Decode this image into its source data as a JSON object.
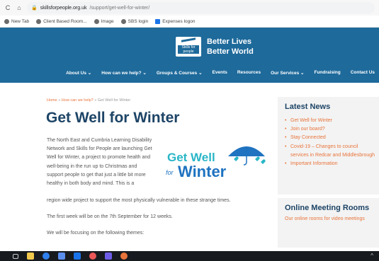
{
  "browser": {
    "url_domain": "skillsforpeople.org.uk",
    "url_path": "/support/get-well-for-winter/",
    "bookmarks": [
      {
        "label": "New Tab",
        "icon": "grid-icon"
      },
      {
        "label": "Client Based Room...",
        "icon": "cloud-icon"
      },
      {
        "label": "Image",
        "icon": "globe-icon"
      },
      {
        "label": "SBS login",
        "icon": "globe-icon"
      },
      {
        "label": "Expenses logon",
        "icon": "document-icon"
      }
    ]
  },
  "header": {
    "logo_text": "Skills for people",
    "tagline_1": "Better Lives",
    "tagline_2": "Better World",
    "nav": [
      "About Us ⌄",
      "How can we help? ⌄",
      "Groups & Courses ⌄",
      "Events",
      "Resources",
      "Our Services ⌄",
      "Fundraising",
      "Contact Us"
    ]
  },
  "breadcrumb": {
    "home": "Home",
    "sep": "»",
    "parent": "How can we help?",
    "current": "Get Well for Winter"
  },
  "article": {
    "title": "Get Well for Winter",
    "intro": "The North East and Cumbria Learning Disability Network and Skills for People are launching Get Well for Winter, a project to promote health and well-being in the run up to Christmas and support people to get that just a little bit more healthy in both body and mind. This is a",
    "intro_tail": "region wide project to support the most physically vulnerable in these strange times.",
    "p2": "The first week will be on the 7th September for 12 weeks.",
    "p3": "We will be focusing on the following themes:"
  },
  "promo_logo": {
    "line1": "Get Well",
    "for": "for",
    "line2": "Winter"
  },
  "sidebar": {
    "news_title": "Latest News",
    "news_items": [
      "Get Well for Winter",
      "Join our board?",
      "Stay Connected",
      "Covid-19 – Changes to council services in Redcar and Middlesbrough",
      "Important Information"
    ],
    "meeting_title": "Online Meeting Rooms",
    "meeting_text": "Our online rooms for video meetings"
  },
  "colors": {
    "header_blue": "#1e6a9b",
    "title_navy": "#1d4466",
    "link_orange": "#e8743b"
  }
}
